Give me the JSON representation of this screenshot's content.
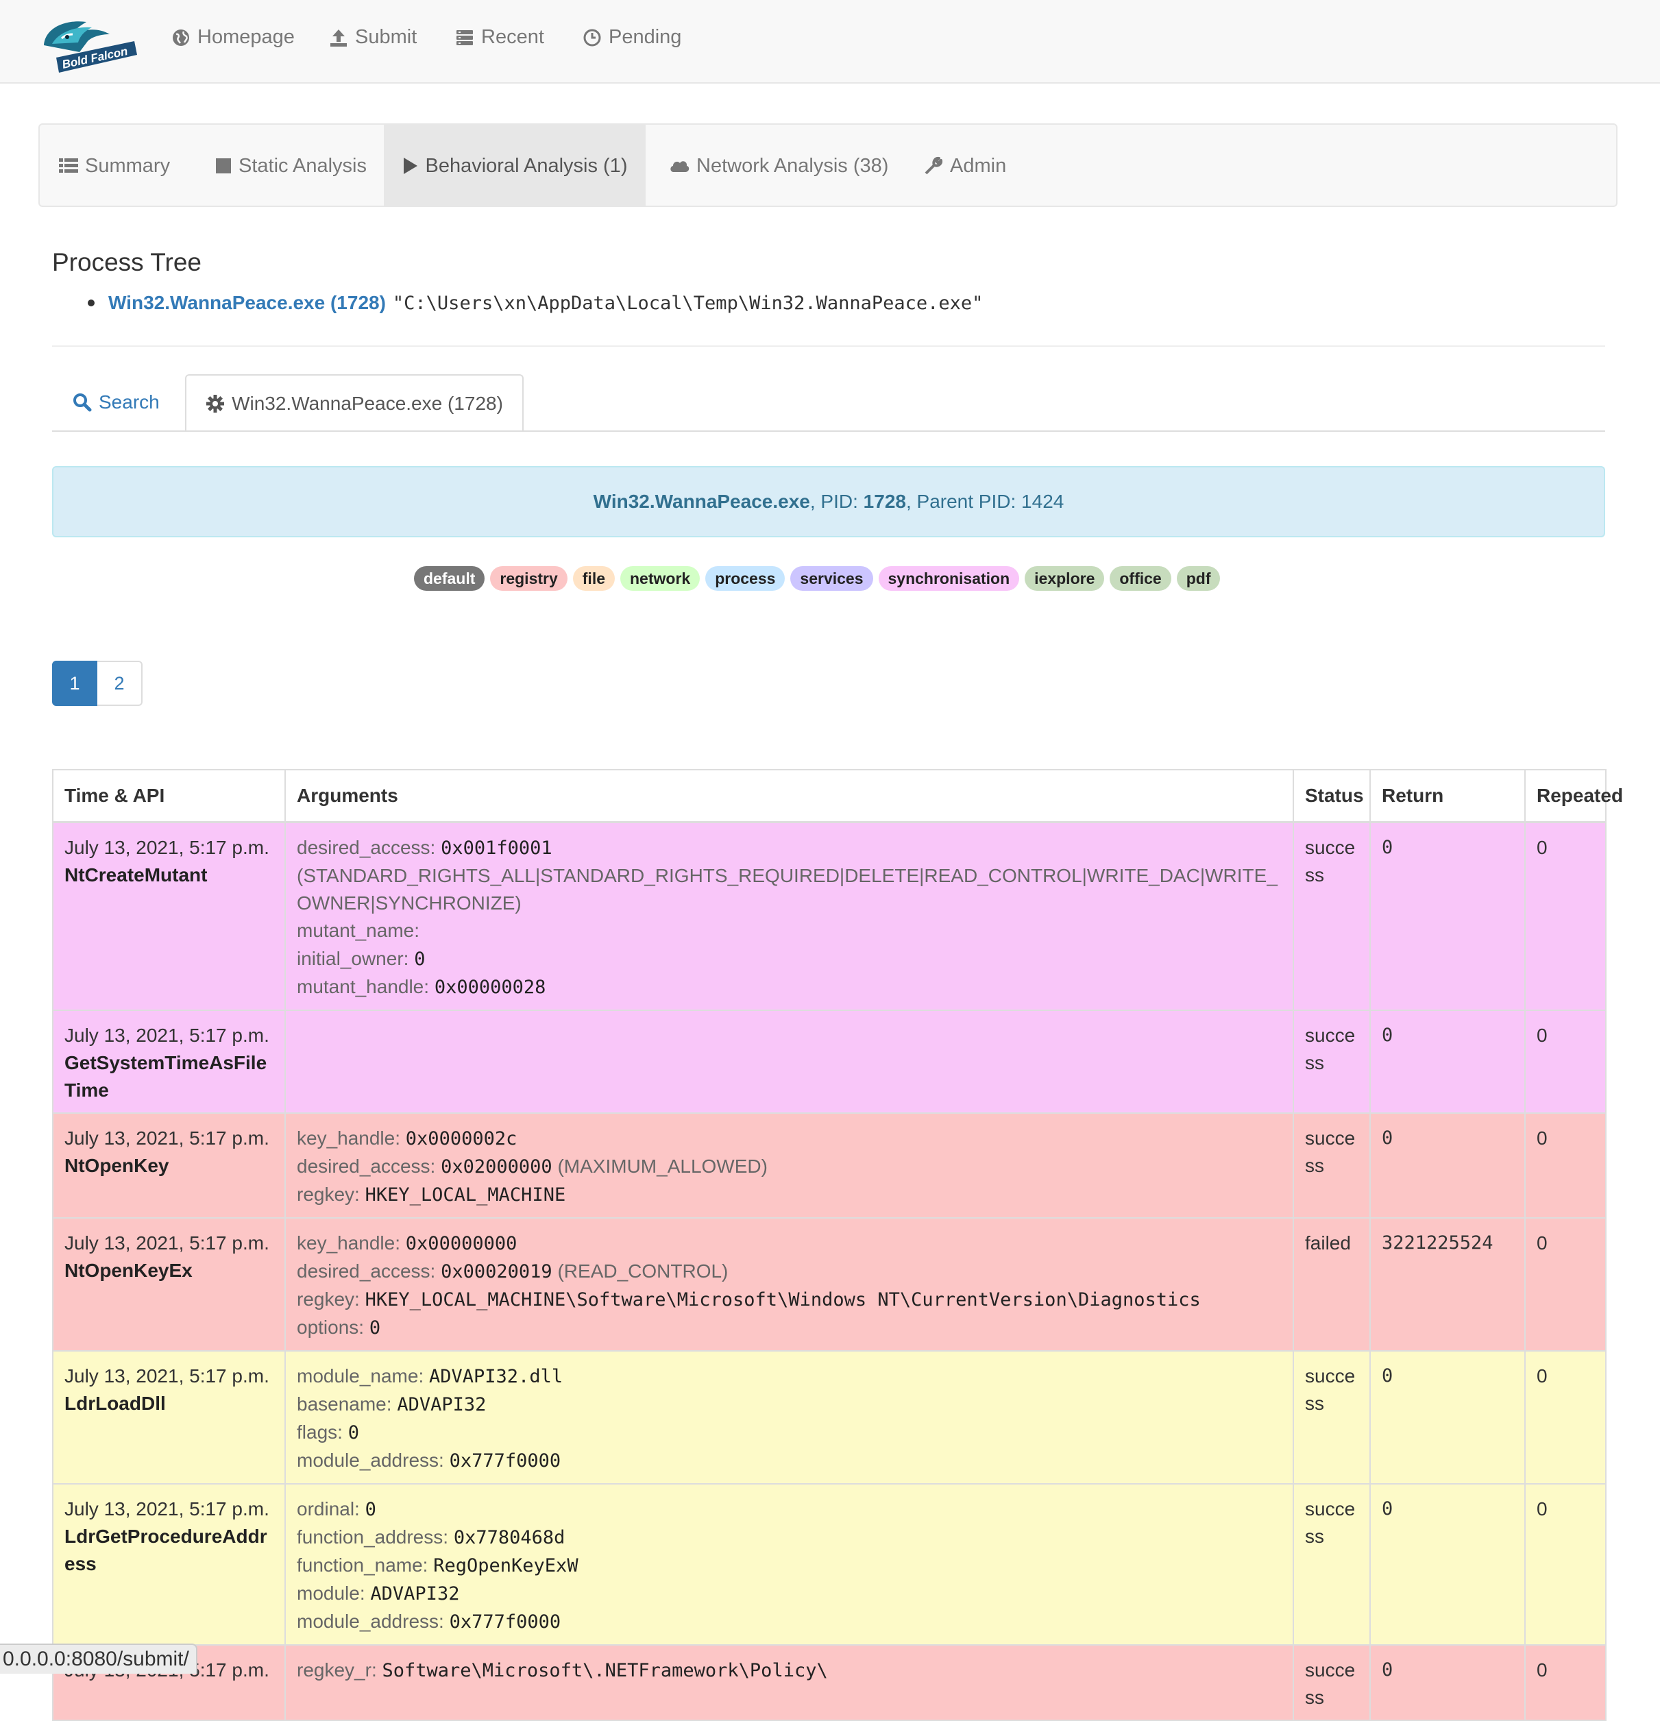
{
  "brand": {
    "name": "Bold Falcon"
  },
  "nav": [
    {
      "label": "Homepage",
      "icon": "globe-icon"
    },
    {
      "label": "Submit",
      "icon": "upload-icon"
    },
    {
      "label": "Recent",
      "icon": "list-icon"
    },
    {
      "label": "Pending",
      "icon": "clock-icon"
    }
  ],
  "tabs": [
    {
      "label": "Summary",
      "icon": "list-icon",
      "active": false
    },
    {
      "label": "Static Analysis",
      "icon": "square-icon",
      "active": false
    },
    {
      "label": "Behavioral Analysis (1)",
      "icon": "play-icon",
      "active": true
    },
    {
      "label": "Network Analysis (38)",
      "icon": "cloud-icon",
      "active": false
    },
    {
      "label": "Admin",
      "icon": "wrench-icon",
      "active": false
    }
  ],
  "process_tree": {
    "title": "Process Tree",
    "items": [
      {
        "name": "Win32.WannaPeace.exe (1728)",
        "command": "\"C:\\Users\\xn\\AppData\\Local\\Temp\\Win32.WannaPeace.exe\""
      }
    ]
  },
  "subtabs": {
    "search": "Search",
    "process": "Win32.WannaPeace.exe (1728)"
  },
  "process_info": {
    "name": "Win32.WannaPeace.exe",
    "pid_label": "PID:",
    "pid": "1728",
    "parent_label": "Parent PID:",
    "parent_pid": "1424"
  },
  "filters": [
    {
      "label": "default",
      "color": "#777777",
      "text": "#ffffff"
    },
    {
      "label": "registry",
      "color": "#fcc6c6",
      "text": "#222222"
    },
    {
      "label": "file",
      "color": "#ffe3c5",
      "text": "#222222"
    },
    {
      "label": "network",
      "color": "#d3ffc6",
      "text": "#222222"
    },
    {
      "label": "process",
      "color": "#c6e6ff",
      "text": "#222222"
    },
    {
      "label": "services",
      "color": "#ccc5ff",
      "text": "#222222"
    },
    {
      "label": "synchronisation",
      "color": "#f9c6f9",
      "text": "#222222"
    },
    {
      "label": "iexplore",
      "color": "#c7dcbd",
      "text": "#222222"
    },
    {
      "label": "office",
      "color": "#c7dcbd",
      "text": "#222222"
    },
    {
      "label": "pdf",
      "color": "#c7dcbd",
      "text": "#222222"
    }
  ],
  "pagination": {
    "pages": [
      "1",
      "2"
    ],
    "current": "1"
  },
  "table": {
    "headers": [
      "Time & API",
      "Arguments",
      "Status",
      "Return",
      "Repeated"
    ],
    "rows": [
      {
        "category": "sync",
        "time": "July 13, 2021, 5:17 p.m.",
        "api": "NtCreateMutant",
        "args": [
          {
            "name": "desired_access:",
            "value": "0x001f0001",
            "desc": "(STANDARD_RIGHTS_ALL|STANDARD_RIGHTS_REQUIRED|DELETE|READ_CONTROL|WRITE_DAC|WRITE_OWNER|SYNCHRONIZE)"
          },
          {
            "name": "mutant_name:",
            "value": ""
          },
          {
            "name": "initial_owner:",
            "value": "0"
          },
          {
            "name": "mutant_handle:",
            "value": "0x00000028"
          }
        ],
        "status": "success",
        "return": "0",
        "repeated": "0"
      },
      {
        "category": "sync",
        "time": "July 13, 2021, 5:17 p.m.",
        "api": "GetSystemTimeAsFileTime",
        "args": [],
        "status": "success",
        "return": "0",
        "repeated": "0"
      },
      {
        "category": "reg",
        "time": "July 13, 2021, 5:17 p.m.",
        "api": "NtOpenKey",
        "args": [
          {
            "name": "key_handle:",
            "value": "0x0000002c"
          },
          {
            "name": "desired_access:",
            "value": "0x02000000",
            "desc": "(MAXIMUM_ALLOWED)"
          },
          {
            "name": "regkey:",
            "value": "HKEY_LOCAL_MACHINE"
          }
        ],
        "status": "success",
        "return": "0",
        "repeated": "0"
      },
      {
        "category": "reg",
        "time": "July 13, 2021, 5:17 p.m.",
        "api": "NtOpenKeyEx",
        "args": [
          {
            "name": "key_handle:",
            "value": "0x00000000"
          },
          {
            "name": "desired_access:",
            "value": "0x00020019",
            "desc": "(READ_CONTROL)"
          },
          {
            "name": "regkey:",
            "value": "HKEY_LOCAL_MACHINE\\Software\\Microsoft\\Windows NT\\CurrentVersion\\Diagnostics"
          },
          {
            "name": "options:",
            "value": "0"
          }
        ],
        "status": "failed",
        "return": "3221225524",
        "repeated": "0"
      },
      {
        "category": "sys",
        "time": "July 13, 2021, 5:17 p.m.",
        "api": "LdrLoadDll",
        "args": [
          {
            "name": "module_name:",
            "value": "ADVAPI32.dll"
          },
          {
            "name": "basename:",
            "value": "ADVAPI32"
          },
          {
            "name": "flags:",
            "value": "0"
          },
          {
            "name": "module_address:",
            "value": "0x777f0000"
          }
        ],
        "status": "success",
        "return": "0",
        "repeated": "0"
      },
      {
        "category": "sys",
        "time": "July 13, 2021, 5:17 p.m.",
        "api": "LdrGetProcedureAddress",
        "args": [
          {
            "name": "ordinal:",
            "value": "0"
          },
          {
            "name": "function_address:",
            "value": "0x7780468d"
          },
          {
            "name": "function_name:",
            "value": "RegOpenKeyExW"
          },
          {
            "name": "module:",
            "value": "ADVAPI32"
          },
          {
            "name": "module_address:",
            "value": "0x777f0000"
          }
        ],
        "status": "success",
        "return": "0",
        "repeated": "0"
      },
      {
        "category": "reg",
        "time": "July 13, 2021, 5:17 p.m.",
        "api": "",
        "args": [
          {
            "name": "regkey_r:",
            "value": "Software\\Microsoft\\.NETFramework\\Policy\\"
          }
        ],
        "status": "success",
        "return": "0",
        "repeated": "0"
      }
    ]
  },
  "statusbar": {
    "url": "0.0.0.0:8080/submit/"
  }
}
